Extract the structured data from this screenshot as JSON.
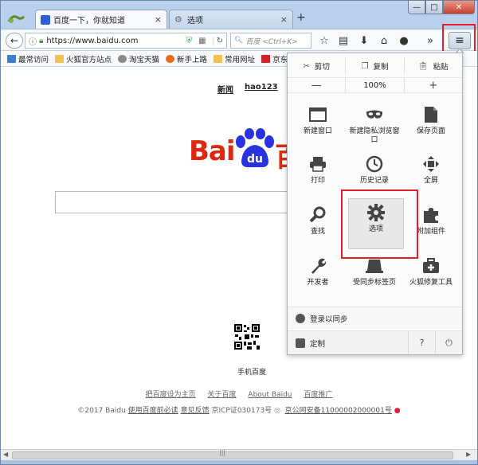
{
  "window": {
    "tabs": [
      {
        "title": "百度一下，你就知道",
        "close": "×"
      },
      {
        "title": "选项",
        "close": "×"
      }
    ],
    "new_tab": "+",
    "controls": {
      "minimize": "—",
      "maximize": "□",
      "close": "✕"
    }
  },
  "navbar": {
    "back": "←",
    "url": "https://www.baidu.com",
    "search_placeholder": "百度 <Ctrl+K>",
    "menu_button": "≡"
  },
  "bookmarks": [
    {
      "label": "最常访问",
      "color": "#3b7fd4"
    },
    {
      "label": "火狐官方站点",
      "color": "#f2c14e"
    },
    {
      "label": "淘宝天猫",
      "color": "#888888"
    },
    {
      "label": "新手上路",
      "color": "#e66a1f"
    },
    {
      "label": "常用网址",
      "color": "#f2c14e"
    },
    {
      "label": "京东",
      "color": "#d4202a"
    }
  ],
  "page": {
    "top_links": [
      "新闻",
      "hao123"
    ],
    "logo_left": "Bai",
    "logo_right": "百",
    "logo_paw": "du",
    "qr_label": "手机百度",
    "footer_links": [
      "把百度设为主页",
      "关于百度",
      "About Baidu",
      "百度推广"
    ],
    "copyright": "©2017 Baidu",
    "footer_u1": "使用百度前必读",
    "footer_u2": "意见反馈",
    "icp": "京ICP证030173号",
    "beian": "京公网安备11000002000001号"
  },
  "menu": {
    "edit": {
      "cut": "剪切",
      "copy": "复制",
      "paste": "粘贴"
    },
    "zoom": {
      "minus": "—",
      "level": "100%",
      "plus": "+"
    },
    "items": [
      {
        "label": "新建窗口",
        "icon": "window-icon"
      },
      {
        "label": "新建隐私浏览窗口",
        "icon": "mask-icon"
      },
      {
        "label": "保存页面",
        "icon": "page-icon"
      },
      {
        "label": "打印",
        "icon": "printer-icon"
      },
      {
        "label": "历史记录",
        "icon": "clock-icon"
      },
      {
        "label": "全屏",
        "icon": "fullscreen-icon"
      },
      {
        "label": "查找",
        "icon": "search-icon"
      },
      {
        "label": "选项",
        "icon": "gear-icon"
      },
      {
        "label": "附加组件",
        "icon": "puzzle-icon"
      },
      {
        "label": "开发者",
        "icon": "wrench-icon"
      },
      {
        "label": "受同步标签页",
        "icon": "sync-tabs-icon"
      },
      {
        "label": "火狐修复工具",
        "icon": "toolbox-icon"
      }
    ],
    "sync": "登录以同步",
    "customize": "定制",
    "help": "?",
    "quit": "⏻"
  }
}
